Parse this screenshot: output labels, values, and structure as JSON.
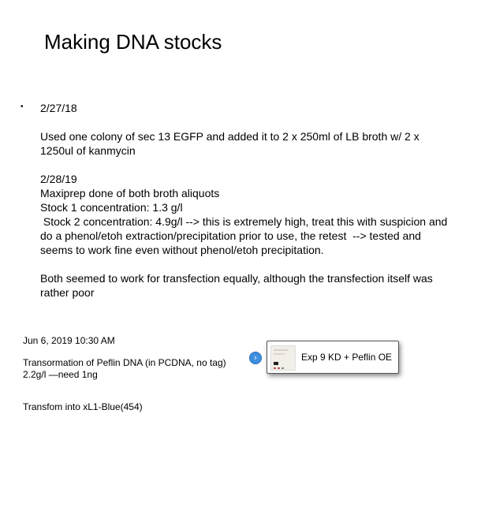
{
  "title": "Making DNA stocks",
  "bullet_char": "•",
  "entry": {
    "date1": "2/27/18",
    "para1_line1": "Used one colony of sec 13 EGFP and added it to 2 x 250ml of LB broth w/ 2 x",
    "para1_line2": "1250ul of kanmycin",
    "date2": "2/28/19",
    "line_maxiprep": "Maxiprep done of both broth aliquots",
    "line_stock1": "Stock 1 concentration: 1.3 g/l",
    "line_stock2_1": " Stock 2 concentration: 4.9g/l --> this is extremely high, treat this with suspicion and",
    "line_stock2_2": "do a phenol/etoh extraction/precipitation prior to use, the retest  --> tested and",
    "line_stock2_3": "seems to work fine even without phenol/etoh precipitation.",
    "line_both1": "Both seemed to work for transfection equally, although the transfection itself was",
    "line_both2": "rather poor"
  },
  "timestamp": "Jun 6, 2019 10:30 AM",
  "transformation_line1": "Transormation of Peflin DNA (in PCDNA, no tag)",
  "transformation_line2": "2.2g/l —need 1ng",
  "transform_into": "Transfom into xL1-Blue(454)",
  "link_card": {
    "arrow_glyph": "›",
    "label": "Exp 9 KD + Peflin OE",
    "icon": "document-thumbnail"
  }
}
